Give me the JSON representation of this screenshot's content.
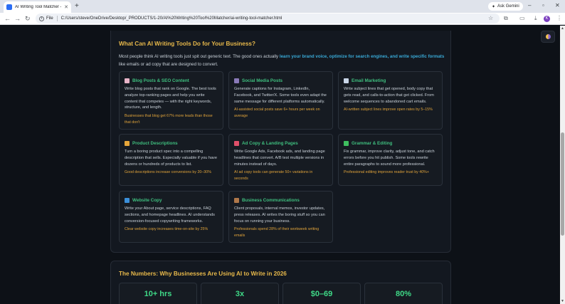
{
  "browser": {
    "tab_title": "AI Writing Tool Matcher - Baker",
    "gemini_label": "Ask Gemini",
    "file_label": "File",
    "url": "C:/Users/steve/OneDrive/Desktop/_PRODUCTS/1-20/AI%20Writing%20Tool%20Matcher/ai-writing-tool-matcher.html",
    "profile_initial": "K"
  },
  "section1": {
    "title": "What Can AI Writing Tools Do for Your Business?",
    "intro_start": "Most people think AI writing tools just spit out generic text. The good ones actually ",
    "intro_highlight": "learn your brand voice, optimize for search engines, and write specific formats",
    "intro_end": " like emails or ad copy that are designed to convert.",
    "cards": [
      {
        "title": "Blog Posts & SEO Content",
        "icon": "document-icon",
        "icon_color": "#e8b4c8",
        "description": "Write blog posts that rank on Google. The best tools analyze top-ranking pages and help you write content that competes — with the right keywords, structure, and length.",
        "stat": "Businesses that blog get 67% more leads than those that don't"
      },
      {
        "title": "Social Media Posts",
        "icon": "phone-icon",
        "icon_color": "#8a7ab8",
        "description": "Generate captions for Instagram, LinkedIn, Facebook, and Twitter/X. Some tools even adapt the same message for different platforms automatically.",
        "stat": "AI-assisted social posts save 6+ hours per week on average"
      },
      {
        "title": "Email Marketing",
        "icon": "envelope-icon",
        "icon_color": "#c9d6e8",
        "description": "Write subject lines that get opened, body copy that gets read, and calls-to-action that get clicked. From welcome sequences to abandoned cart emails.",
        "stat": "AI-written subject lines improve open rates by 5–15%"
      },
      {
        "title": "Product Descriptions",
        "icon": "tag-icon",
        "icon_color": "#e6a63a",
        "description": "Turn a boring product spec into a compelling description that sells. Especially valuable if you have dozens or hundreds of products to list.",
        "stat": "Good descriptions increase conversions by 20–30%"
      },
      {
        "title": "Ad Copy & Landing Pages",
        "icon": "megaphone-icon",
        "icon_color": "#e0506a",
        "description": "Write Google Ads, Facebook ads, and landing page headlines that convert. A/B test multiple versions in minutes instead of days.",
        "stat": "AI ad copy tools can generate 50+ variations in seconds"
      },
      {
        "title": "Grammar & Editing",
        "icon": "checkmark-icon",
        "icon_color": "#3fbf5f",
        "description": "Fix grammar, improve clarity, adjust tone, and catch errors before you hit publish. Some tools rewrite entire paragraphs to sound more professional.",
        "stat": "Professional editing improves reader trust by 40%+"
      },
      {
        "title": "Website Copy",
        "icon": "globe-icon",
        "icon_color": "#3b8fd9",
        "description": "Write your About page, service descriptions, FAQ sections, and homepage headlines. AI understands conversion-focused copywriting frameworks.",
        "stat": "Clear website copy increases time-on-site by 25%"
      },
      {
        "title": "Business Communications",
        "icon": "briefcase-icon",
        "icon_color": "#b0784a",
        "description": "Client proposals, internal memos, investor updates, press releases. AI writes the boring stuff so you can focus on running your business.",
        "stat": "Professionals spend 28% of their workweek writing emails"
      }
    ]
  },
  "section2": {
    "title": "The Numbers: Why Businesses Are Using AI to Write in 2026",
    "stats": [
      {
        "value": "10+ hrs"
      },
      {
        "value": "3x"
      },
      {
        "value": "$0–69"
      },
      {
        "value": "80%"
      }
    ]
  }
}
